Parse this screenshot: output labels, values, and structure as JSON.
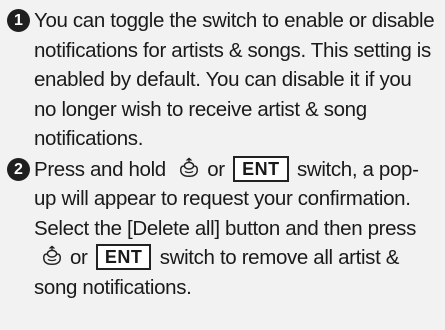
{
  "steps": [
    {
      "number": "1",
      "text": "You can toggle the switch to enable or disable notifications for artists & songs. This setting is enabled by default. You can disable it if you no longer wish to receive artist & song notifications."
    },
    {
      "number": "2",
      "part1": "Press and hold",
      "or1": "or",
      "key1": "ENT",
      "part2": "switch, a pop-up will appear to request your confirmation. Select the [Delete all] button and then press",
      "or2": "or",
      "key2": "ENT",
      "part3": "switch to remove all artist & song notifications."
    }
  ],
  "icons": {
    "dial": "interface-dial-icon"
  }
}
